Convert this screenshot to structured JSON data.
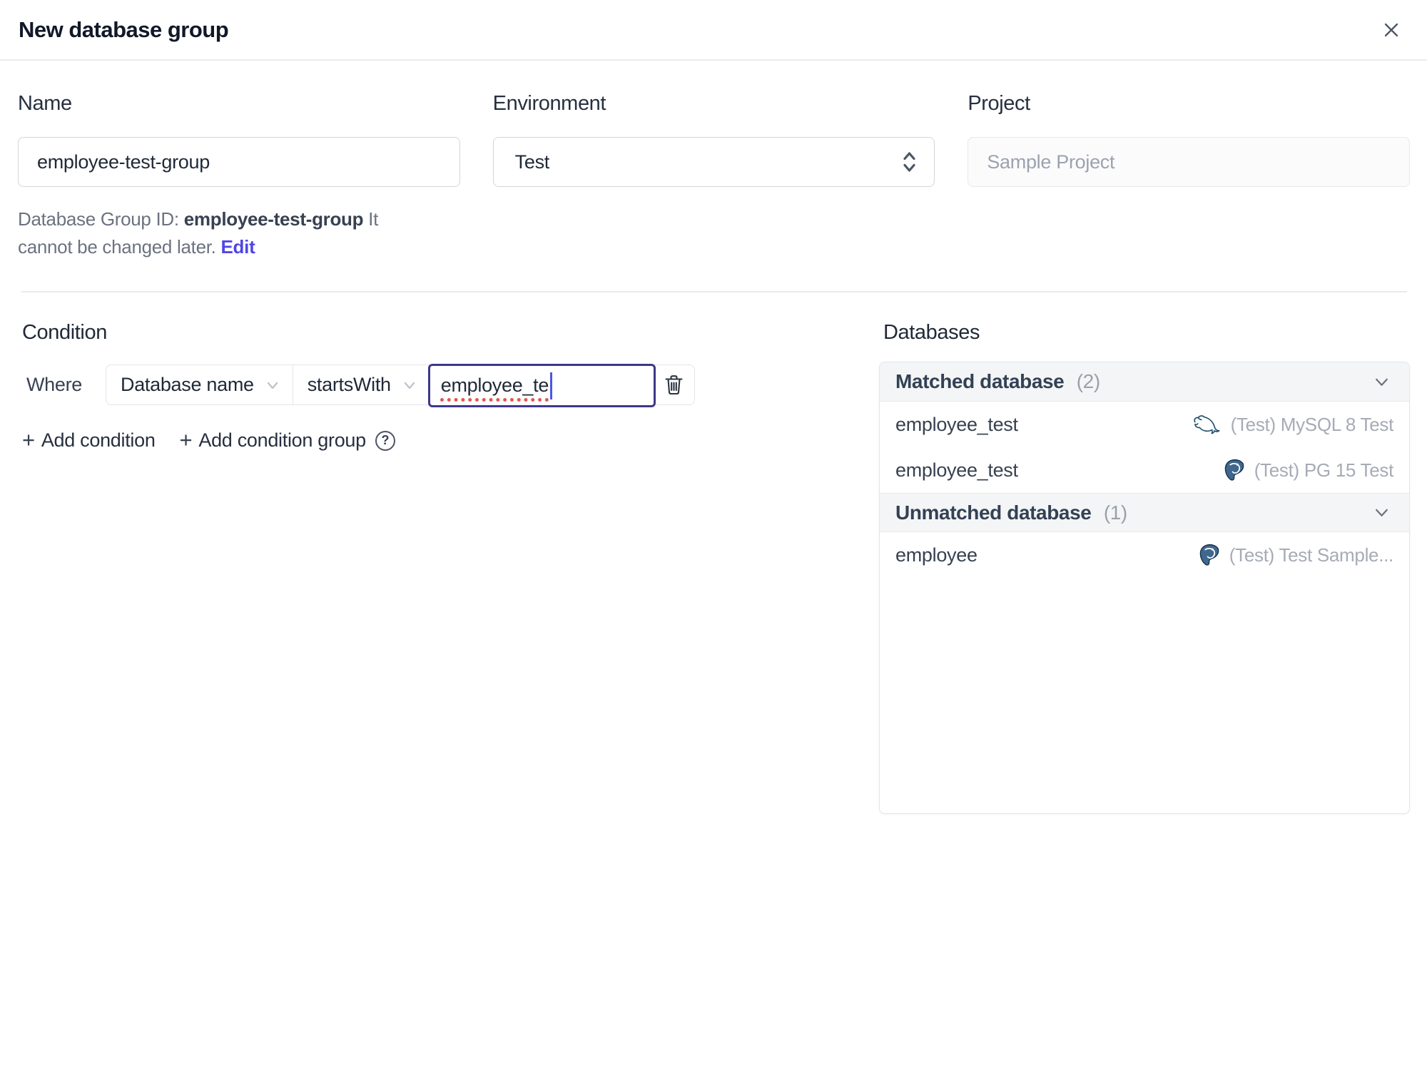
{
  "dialog": {
    "title": "New database group"
  },
  "form": {
    "name": {
      "label": "Name",
      "value": "employee-test-group"
    },
    "environment": {
      "label": "Environment",
      "value": "Test"
    },
    "project": {
      "label": "Project",
      "value": "Sample Project"
    },
    "group_id": {
      "prefix": "Database Group ID: ",
      "id": "employee-test-group",
      "suffix": " It cannot be changed later. ",
      "edit_label": "Edit"
    }
  },
  "condition": {
    "heading": "Condition",
    "where_label": "Where",
    "factor": "Database name",
    "operator": "startsWith",
    "value": "employee_te",
    "add_condition_label": "Add condition",
    "add_condition_group_label": "Add condition group"
  },
  "icons": {
    "plus": "+",
    "help": "?"
  },
  "databases": {
    "heading": "Databases",
    "groups": [
      {
        "title": "Matched database",
        "count": "(2)",
        "rows": [
          {
            "name": "employee_test",
            "engine": "mysql",
            "instance": "(Test) MySQL 8 Test"
          },
          {
            "name": "employee_test",
            "engine": "postgres",
            "instance": "(Test) PG 15 Test"
          }
        ]
      },
      {
        "title": "Unmatched database",
        "count": "(1)",
        "rows": [
          {
            "name": "employee",
            "engine": "postgres",
            "instance": "(Test) Test Sample..."
          }
        ]
      }
    ]
  },
  "colors": {
    "accent": "#4f46e5",
    "focus_border": "#3e3888",
    "spellcheck_underline": "#e0594e",
    "panel_header_bg": "#f4f5f6",
    "border": "#e5e7eb"
  }
}
